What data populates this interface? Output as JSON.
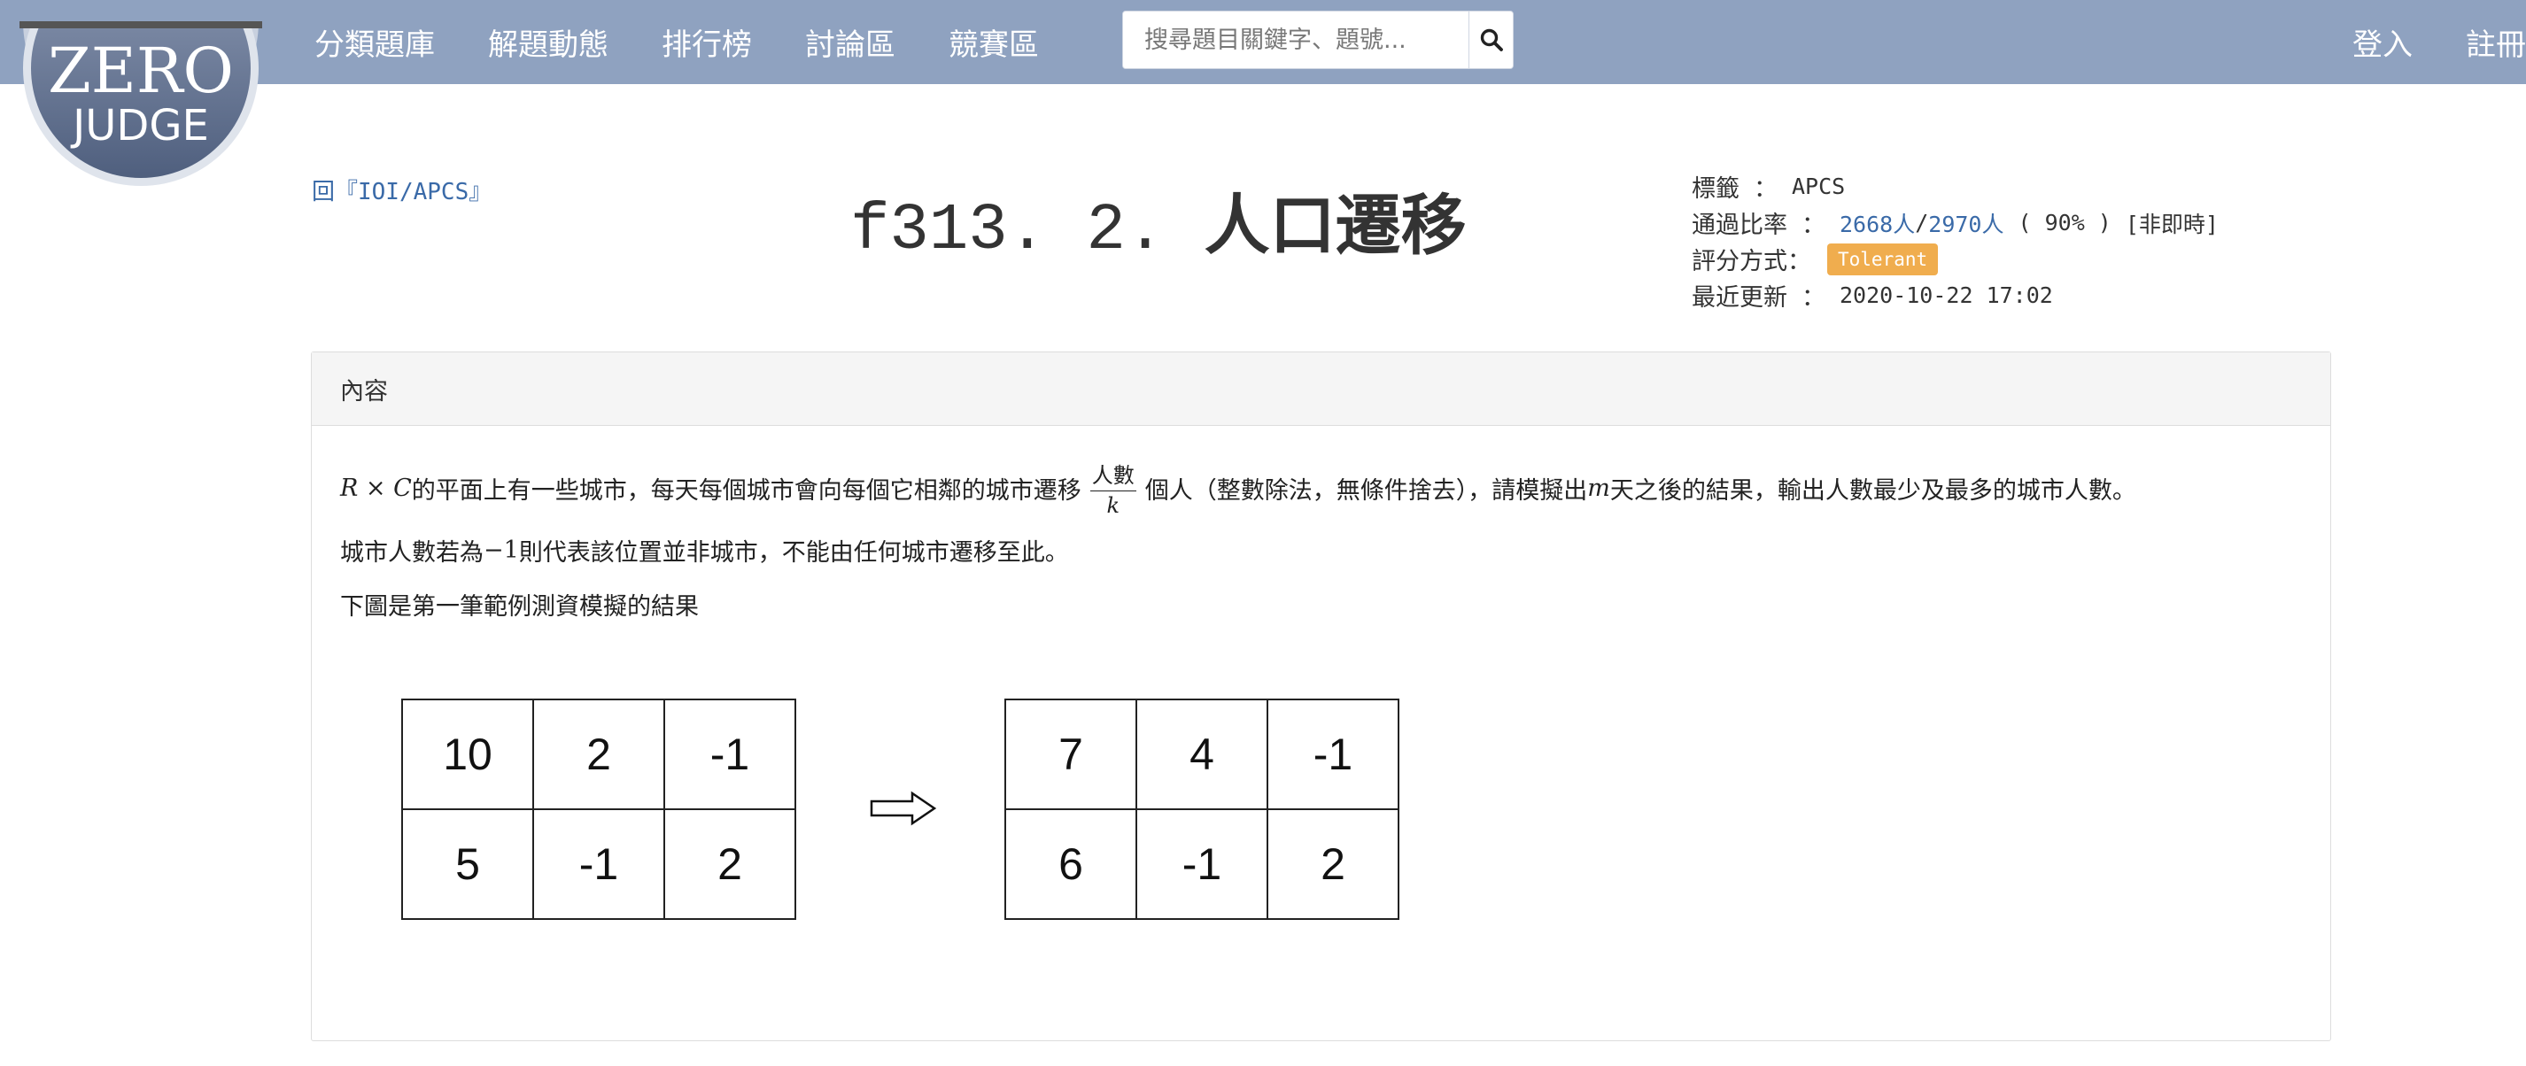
{
  "logo": {
    "line1": "ZERO",
    "line2": "JUDGE"
  },
  "nav": {
    "items": [
      "分類題庫",
      "解題動態",
      "排行榜",
      "討論區",
      "競賽區"
    ],
    "search_placeholder": "搜尋題目關鍵字、題號...",
    "login": "登入",
    "register": "註冊"
  },
  "problem": {
    "tag_link": "回『IOI/APCS』",
    "id": "f313. 2. ",
    "name": "人口遷移"
  },
  "meta": {
    "tag_label": "標籤",
    "tag_value": "APCS",
    "pass_label": "通過比率",
    "pass_accepted": "2668人",
    "pass_slash": "/",
    "pass_total": "2970人",
    "pass_percent": "( 90% )",
    "pass_realtime": "[非即時]",
    "judge_label": "評分方式：",
    "judge_value": "Tolerant",
    "updated_label": "最近更新",
    "updated_value": "2020-10-22 17:02",
    "colon": "："
  },
  "content": {
    "heading": "內容",
    "line1": {
      "math_prefix": "R × C",
      "text_a": " 的平面上有一些城市，每天每個城市會向每個它相鄰的城市遷移 ",
      "frac_num": "人數",
      "frac_den": "k",
      "text_b": " 個人（整數除法，無條件捨去），請模擬出 ",
      "math_m": "m",
      "text_c": " 天之後的結果，輸出人數最少及最多的城市人數。"
    },
    "line2": {
      "text_a": "城市人數若為 ",
      "math": "−1",
      "text_b": " 則代表該位置並非城市，不能由任何城市遷移至此。"
    },
    "line3": "下圖是第一筆範例測資模擬的結果",
    "grid_before": [
      [
        "10",
        "2",
        "-1"
      ],
      [
        "5",
        "-1",
        "2"
      ]
    ],
    "grid_after": [
      [
        "7",
        "4",
        "-1"
      ],
      [
        "6",
        "-1",
        "2"
      ]
    ]
  },
  "colors": {
    "navbar": "#8fa2c0",
    "link": "#3a6aa8",
    "badge": "#f0ad4e"
  },
  "icons": {
    "search": "search-icon",
    "arrow": "right-arrow-icon",
    "back": "back-icon"
  }
}
